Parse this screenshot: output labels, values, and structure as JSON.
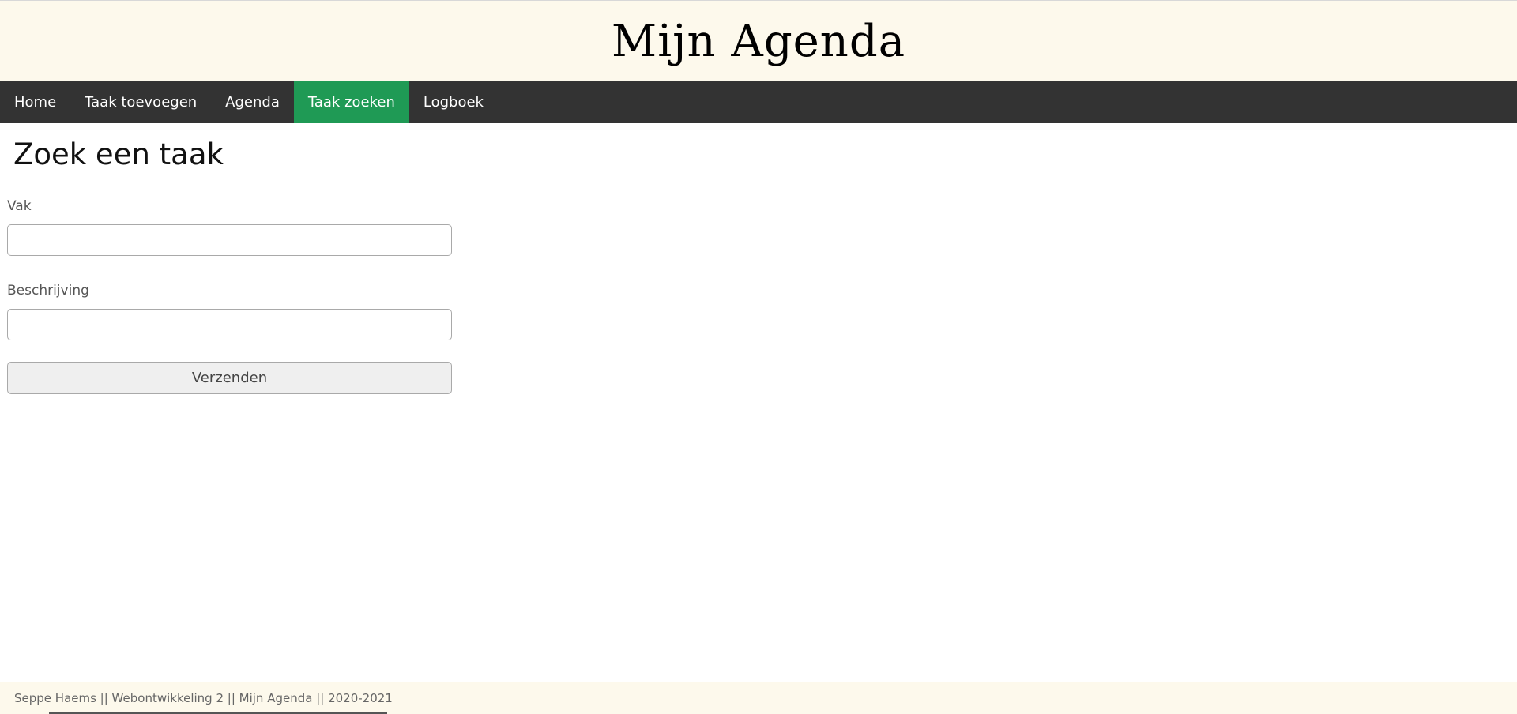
{
  "header": {
    "title": "Mijn Agenda"
  },
  "nav": {
    "items": [
      {
        "label": "Home"
      },
      {
        "label": "Taak toevoegen"
      },
      {
        "label": "Agenda"
      },
      {
        "label": "Taak zoeken"
      },
      {
        "label": "Logboek"
      }
    ],
    "active": "Taak zoeken"
  },
  "main": {
    "heading": "Zoek een taak",
    "fields": [
      {
        "label": "Vak",
        "value": ""
      },
      {
        "label": "Beschrijving",
        "value": ""
      }
    ],
    "submit_label": "Verzenden"
  },
  "footer": {
    "text": "Seppe Haems || Webontwikkeling 2 || Mijn Agenda || 2020-2021"
  },
  "colors": {
    "header_bg": "#fdf9ec",
    "nav_bg": "#333333",
    "nav_active": "#1f9a55",
    "footer_bg": "#fdf9ec"
  }
}
